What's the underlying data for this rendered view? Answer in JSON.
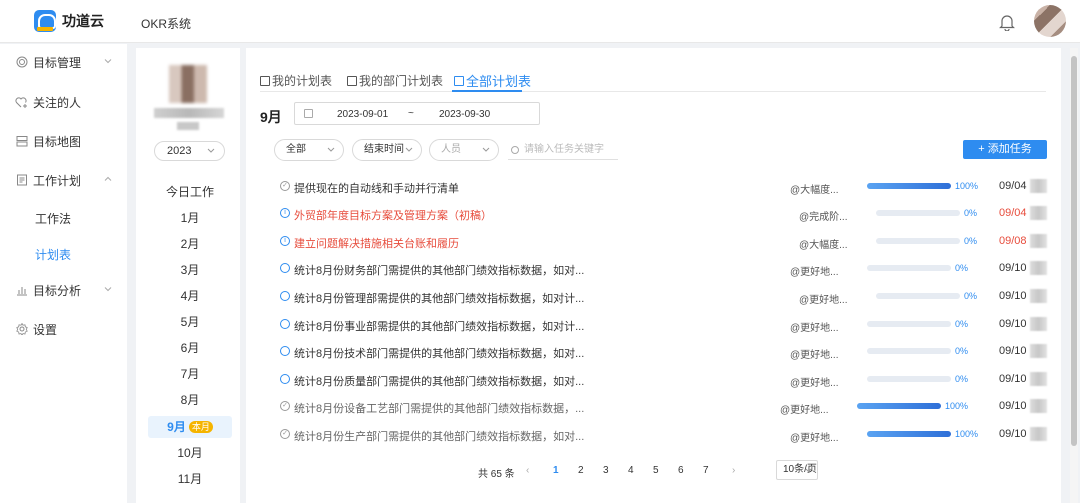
{
  "header": {
    "brand": "功道云",
    "system": "OKR系统"
  },
  "sidebar": {
    "items": [
      {
        "label": "目标管理",
        "icon": "target-icon"
      },
      {
        "label": "关注的人",
        "icon": "heart-plus-icon"
      },
      {
        "label": "目标地图",
        "icon": "map-icon"
      },
      {
        "label": "工作计划",
        "icon": "document-icon"
      },
      {
        "label": "目标分析",
        "icon": "bar-chart-icon"
      },
      {
        "label": "设置",
        "icon": "gear-icon"
      }
    ],
    "sub_items": [
      {
        "label": "工作法"
      },
      {
        "label": "计划表"
      }
    ]
  },
  "months_panel": {
    "year": "2023",
    "today": "今日工作",
    "months": [
      "1月",
      "2月",
      "3月",
      "4月",
      "5月",
      "6月",
      "7月",
      "8月",
      "9月",
      "10月",
      "11月"
    ],
    "current_badge": "本月"
  },
  "tabs": [
    {
      "label": "我的计划表"
    },
    {
      "label": "我的部门计划表"
    },
    {
      "label": "全部计划表"
    }
  ],
  "filters": {
    "month_label": "9月",
    "date_start": "2023-09-01",
    "date_sep": "~",
    "date_end": "2023-09-30",
    "scope": "全部",
    "sort": "结束时间",
    "person_placeholder": "人员",
    "search_placeholder": "请输入任务关键字",
    "add_button": "+ 添加任务"
  },
  "tasks": [
    {
      "title": "提供现在的自动线和手动并行清单",
      "tag": "@大幅度...",
      "progress": "100%",
      "date": "09/04"
    },
    {
      "title": "外贸部年度目标方案及管理方案（初稿）",
      "tag": "@完成阶...",
      "progress": "0%",
      "date": "09/04"
    },
    {
      "title": "建立问题解决措施相关台账和履历",
      "tag": "@大幅度...",
      "progress": "0%",
      "date": "09/08"
    },
    {
      "title": "统计8月份财务部门需提供的其他部门绩效指标数据，如对...",
      "tag": "@更好地...",
      "progress": "0%",
      "date": "09/10"
    },
    {
      "title": "统计8月份管理部需提供的其他部门绩效指标数据，如对计...",
      "tag": "@更好地...",
      "progress": "0%",
      "date": "09/10"
    },
    {
      "title": "统计8月份事业部需提供的其他部门绩效指标数据，如对计...",
      "tag": "@更好地...",
      "progress": "0%",
      "date": "09/10"
    },
    {
      "title": "统计8月份技术部门需提供的其他部门绩效指标数据，如对...",
      "tag": "@更好地...",
      "progress": "0%",
      "date": "09/10"
    },
    {
      "title": "统计8月份质量部门需提供的其他部门绩效指标数据，如对...",
      "tag": "@更好地...",
      "progress": "0%",
      "date": "09/10"
    },
    {
      "title": "统计8月份设备工艺部门需提供的其他部门绩效指标数据，...",
      "tag": "@更好地...",
      "progress": "100%",
      "date": "09/10"
    },
    {
      "title": "统计8月份生产部门需提供的其他部门绩效指标数据，如对...",
      "tag": "@更好地...",
      "progress": "100%",
      "date": "09/10"
    }
  ],
  "pagination": {
    "total": "共 65 条",
    "pages": [
      "1",
      "2",
      "3",
      "4",
      "5",
      "6",
      "7"
    ],
    "page_size": "10条/页"
  },
  "colors": {
    "accent": "#2e8cf0",
    "urgent": "#e74c3c",
    "badge": "#f5b400"
  }
}
